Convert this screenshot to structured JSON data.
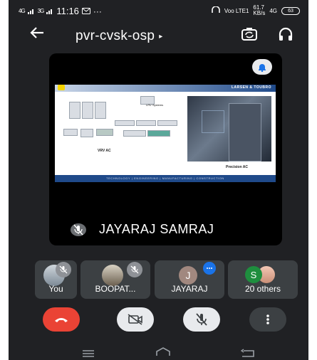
{
  "status_bar": {
    "signal_1": "4G",
    "signal_2": "3G",
    "time": "11:16",
    "more": "···",
    "network_label": "Voo LTE1",
    "speed_value": "61.7",
    "speed_unit": "KB/s",
    "network_type": "4G",
    "battery_level": "63"
  },
  "header": {
    "meeting_title": "pvr-cvsk-osp",
    "title_arrow": "▸"
  },
  "main_tile": {
    "speaker_name": "JAYARAJ SAMRAJ",
    "slide": {
      "brand": "LARSEN & TOUBRO",
      "label_left": "VRV AC",
      "label_small": "LRV Systems",
      "label_right": "Precision AC",
      "footer": "TECHNOLOGY | ENGINEERING | MANUFACTURING | CONSTRUCTION"
    }
  },
  "participants": [
    {
      "label": "You"
    },
    {
      "label": "BOOPAT..."
    },
    {
      "label": "JAYARAJ",
      "initial": "J"
    },
    {
      "label": "20 others",
      "initial": "S"
    }
  ],
  "colors": {
    "background": "#202124",
    "tile": "#3c4043",
    "end_call": "#ea4335",
    "control_light": "#e8eaed",
    "avatar_j": "#a1887f",
    "avatar_s": "#1e8e3e",
    "speaking_badge": "#1a73e8"
  },
  "icons": [
    "back-arrow-icon",
    "camera-switch-icon",
    "headphones-icon",
    "bell-icon",
    "mic-off-icon",
    "end-call-icon",
    "camera-off-icon",
    "more-vert-icon"
  ]
}
